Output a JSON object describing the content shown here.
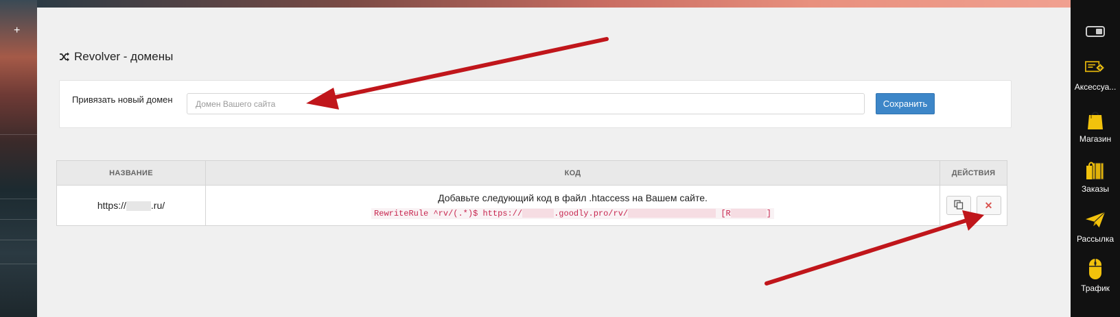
{
  "page": {
    "title": "Revolver - домены"
  },
  "form": {
    "label": "Привязать новый домен",
    "placeholder": "Домен Вашего сайта",
    "save_label": "Сохранить"
  },
  "table": {
    "headers": [
      "НАЗВАНИЕ",
      "КОД",
      "ДЕЙСТВИЯ"
    ],
    "rows": [
      {
        "name_prefix": "https://",
        "name_suffix": ".ru/",
        "code_note": "Добавьте следующий код в файл .htaccess на Вашем сайте.",
        "code_part1": "RewriteRule ^rv/(.*)$ https://",
        "code_part2": ".goodly.pro/rv/",
        "code_part3": " [R",
        "code_part4": "]"
      }
    ]
  },
  "sidebar": {
    "items": [
      {
        "label": "Аксессуа...",
        "icon": "accessories-icon"
      },
      {
        "label": "Магазин",
        "icon": "shopping-bag-icon"
      },
      {
        "label": "Заказы",
        "icon": "orders-icon"
      },
      {
        "label": "Рассылка",
        "icon": "paper-plane-icon"
      },
      {
        "label": "Трафик",
        "icon": "mouse-icon"
      }
    ]
  },
  "left_strip": {
    "plus_label": "+"
  },
  "colors": {
    "accent": "#3d86c8",
    "danger": "#d9534f",
    "code": "#c7254e",
    "arrow": "#c0161b",
    "sidebar_bg": "#111111"
  }
}
